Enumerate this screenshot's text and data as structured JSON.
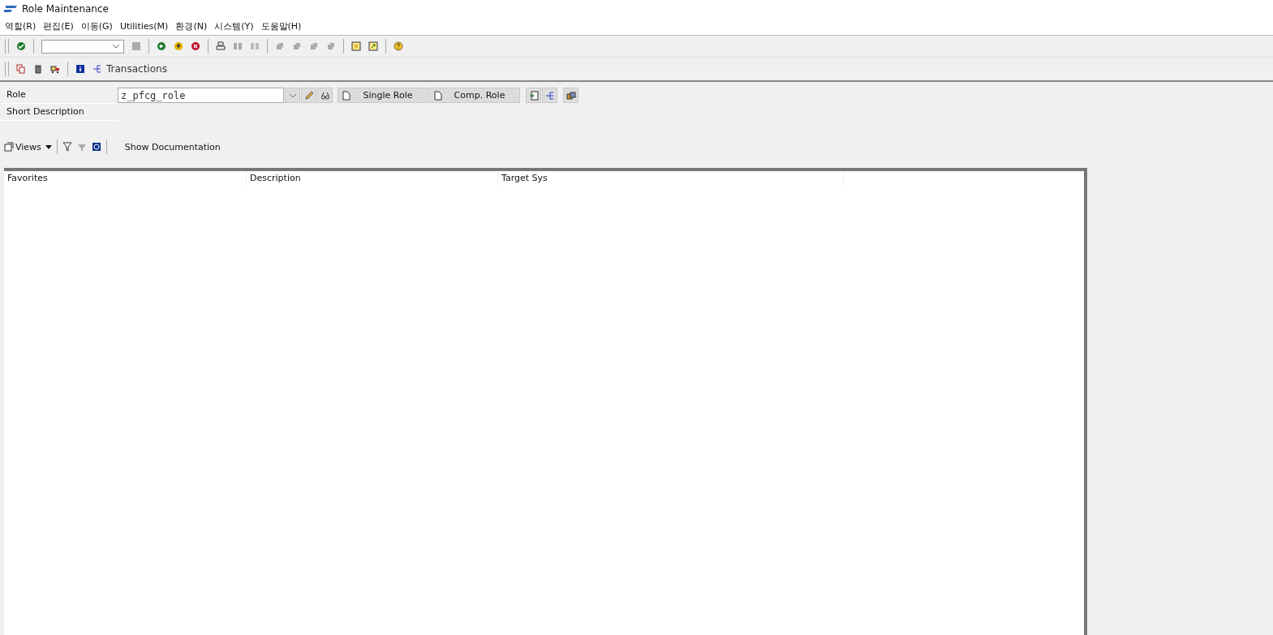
{
  "window": {
    "title": "Role Maintenance"
  },
  "menu": [
    "역할(R)",
    "편집(E)",
    "이동(G)",
    "Utilities(M)",
    "환경(N)",
    "시스템(Y)",
    "도움말(H)"
  ],
  "app_toolbar": {
    "transactions_label": "Transactions"
  },
  "role_field": {
    "label": "Role",
    "value": "z_pfcg_role"
  },
  "role_buttons": [
    "Single Role",
    "Comp. Role"
  ],
  "short_description": {
    "label": "Short Description"
  },
  "tree_toolbar": {
    "views_label": "Views",
    "documentation_button": "Show Documentation"
  },
  "table": {
    "columns": [
      "Favorites",
      "Description",
      "Target Sys"
    ]
  }
}
